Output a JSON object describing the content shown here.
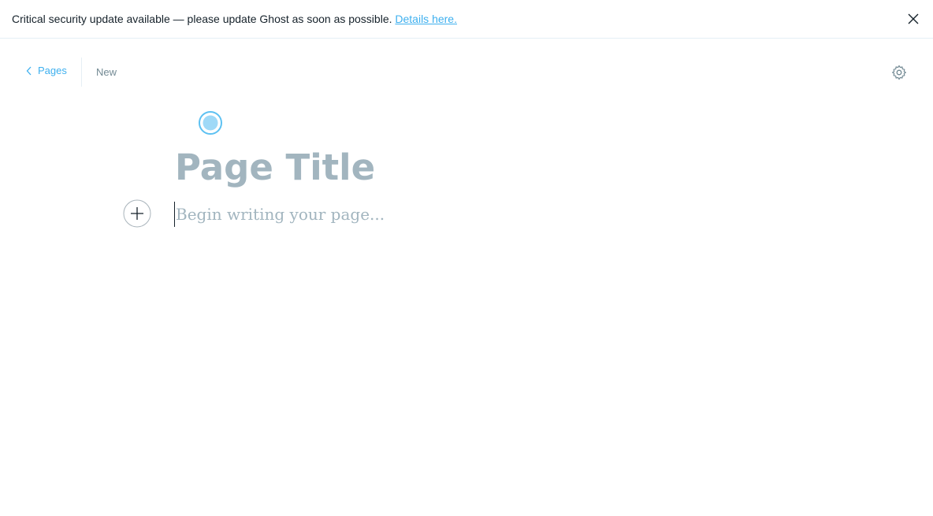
{
  "banner": {
    "message": "Critical security update available — please update Ghost as soon as possible.",
    "link_text": "Details here."
  },
  "nav": {
    "back_label": "Pages",
    "status": "New"
  },
  "editor": {
    "title_placeholder": "Page Title",
    "body_placeholder": "Begin writing your page..."
  },
  "colors": {
    "accent": "#3eb0ef",
    "placeholder": "#a2b5bf",
    "divider": "#e5eff5"
  }
}
